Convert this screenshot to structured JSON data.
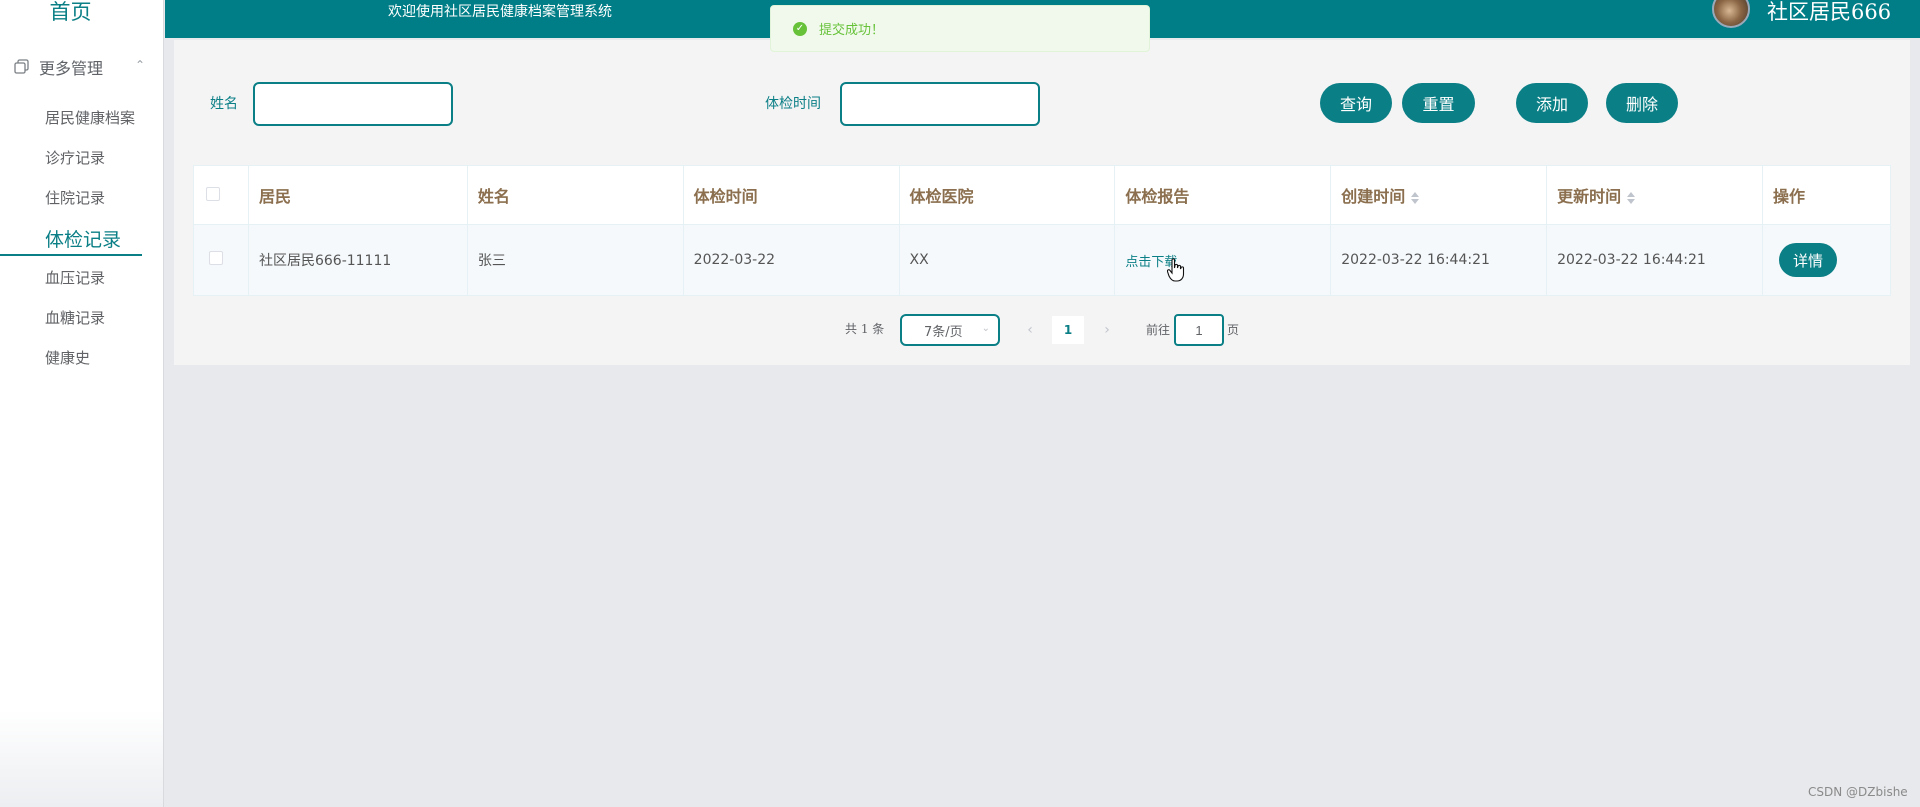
{
  "sidebar": {
    "home": "首页",
    "group_label": "更多管理",
    "items": [
      {
        "label": "居民健康档案"
      },
      {
        "label": "诊疗记录"
      },
      {
        "label": "住院记录"
      },
      {
        "label": "体检记录"
      },
      {
        "label": "血压记录"
      },
      {
        "label": "血糖记录"
      },
      {
        "label": "健康史"
      }
    ]
  },
  "header": {
    "welcome": "欢迎使用社区居民健康档案管理系统",
    "username": "社区居民666"
  },
  "toast": {
    "message": "提交成功！"
  },
  "search": {
    "name_label": "姓名",
    "name_value": "",
    "date_label": "体检时间",
    "date_value": ""
  },
  "toolbar": {
    "query_label": "查询",
    "reset_label": "重置",
    "add_label": "添加",
    "delete_label": "删除"
  },
  "table": {
    "columns": [
      "居民",
      "姓名",
      "体检时间",
      "体检医院",
      "体检报告",
      "创建时间",
      "更新时间",
      "操作"
    ],
    "rows": [
      {
        "resident": "社区居民666-11111",
        "name": "张三",
        "exam_time": "2022-03-22",
        "hospital": "XX",
        "report": "点击下载",
        "created": "2022-03-22 16:44:21",
        "updated": "2022-03-22 16:44:21",
        "action": "详情"
      }
    ]
  },
  "pagination": {
    "total": "共 1 条",
    "page_size": "7条/页",
    "current_page": "1",
    "goto_prefix": "前往",
    "goto_value": "1",
    "goto_suffix": "页"
  },
  "watermark": "CSDN @DZbishe",
  "colors": {
    "accent": "#007e87",
    "header_text": "#8b6f4e",
    "success": "#67c23a"
  }
}
